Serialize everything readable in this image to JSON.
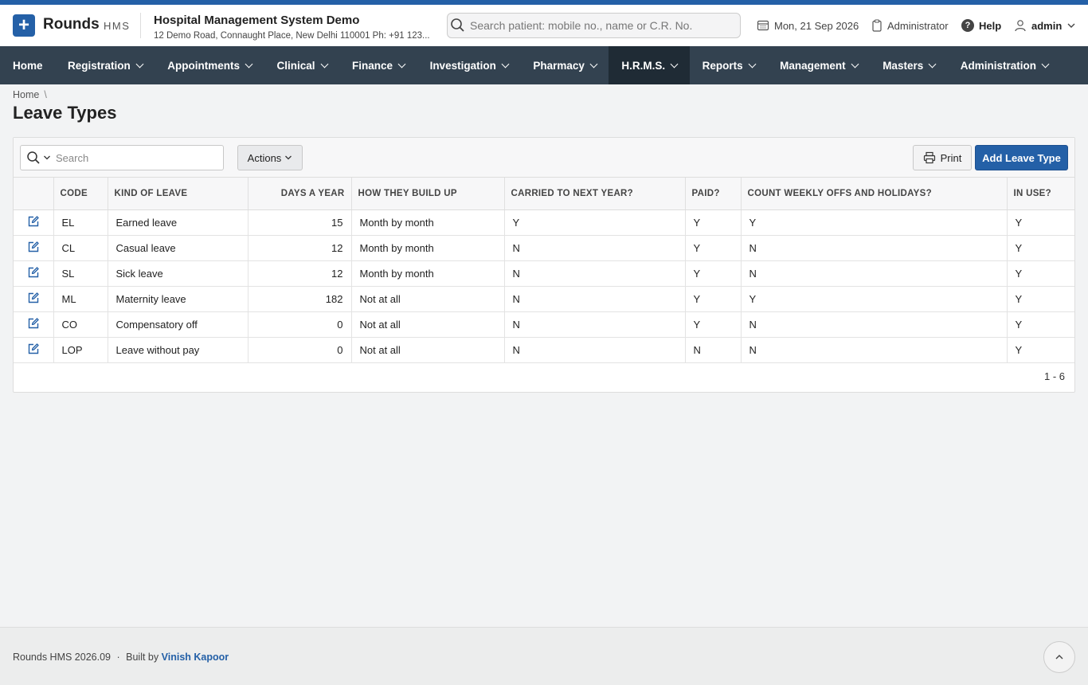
{
  "app": {
    "brand": "Rounds",
    "brand_sub": "HMS",
    "hospital_name": "Hospital Management System Demo",
    "hospital_address": "12 Demo Road, Connaught Place, New Delhi 110001 Ph: +91 123..."
  },
  "header": {
    "search_placeholder": "Search patient: mobile no., name or C.R. No.",
    "date": "Mon, 21 Sep 2026",
    "role": "Administrator",
    "help": "Help",
    "user": "admin"
  },
  "nav": {
    "items": [
      {
        "label": "Home",
        "dropdown": false
      },
      {
        "label": "Registration",
        "dropdown": true
      },
      {
        "label": "Appointments",
        "dropdown": true
      },
      {
        "label": "Clinical",
        "dropdown": true
      },
      {
        "label": "Finance",
        "dropdown": true
      },
      {
        "label": "Investigation",
        "dropdown": true
      },
      {
        "label": "Pharmacy",
        "dropdown": true
      },
      {
        "label": "H.R.M.S.",
        "dropdown": true,
        "active": true
      },
      {
        "label": "Reports",
        "dropdown": true
      },
      {
        "label": "Management",
        "dropdown": true
      },
      {
        "label": "Masters",
        "dropdown": true
      },
      {
        "label": "Administration",
        "dropdown": true
      }
    ]
  },
  "breadcrumb": {
    "home": "Home",
    "separator": "\\"
  },
  "page": {
    "title": "Leave Types"
  },
  "toolbar": {
    "search_placeholder": "Search",
    "actions_label": "Actions",
    "print_label": "Print",
    "add_label": "Add Leave Type"
  },
  "table": {
    "columns": [
      "",
      "CODE",
      "KIND OF LEAVE",
      "DAYS A YEAR",
      "HOW THEY BUILD UP",
      "CARRIED TO NEXT YEAR?",
      "PAID?",
      "COUNT WEEKLY OFFS AND HOLIDAYS?",
      "IN USE?"
    ],
    "rows": [
      {
        "code": "EL",
        "kind": "Earned leave",
        "days": "15",
        "build": "Month by month",
        "carried": "Y",
        "paid": "Y",
        "count_offs": "Y",
        "in_use": "Y"
      },
      {
        "code": "CL",
        "kind": "Casual leave",
        "days": "12",
        "build": "Month by month",
        "carried": "N",
        "paid": "Y",
        "count_offs": "N",
        "in_use": "Y"
      },
      {
        "code": "SL",
        "kind": "Sick leave",
        "days": "12",
        "build": "Month by month",
        "carried": "N",
        "paid": "Y",
        "count_offs": "N",
        "in_use": "Y"
      },
      {
        "code": "ML",
        "kind": "Maternity leave",
        "days": "182",
        "build": "Not at all",
        "carried": "N",
        "paid": "Y",
        "count_offs": "Y",
        "in_use": "Y"
      },
      {
        "code": "CO",
        "kind": "Compensatory off",
        "days": "0",
        "build": "Not at all",
        "carried": "N",
        "paid": "Y",
        "count_offs": "N",
        "in_use": "Y"
      },
      {
        "code": "LOP",
        "kind": "Leave without pay",
        "days": "0",
        "build": "Not at all",
        "carried": "N",
        "paid": "N",
        "count_offs": "N",
        "in_use": "Y"
      }
    ],
    "pager": "1 - 6"
  },
  "footer": {
    "version": "Rounds HMS 2026.09",
    "dot": "·",
    "built_by": "Built by",
    "author": "Vinish Kapoor"
  },
  "colors": {
    "brand": "#2460a7",
    "navbar": "#334250",
    "navbar_active": "#1f2b35"
  }
}
